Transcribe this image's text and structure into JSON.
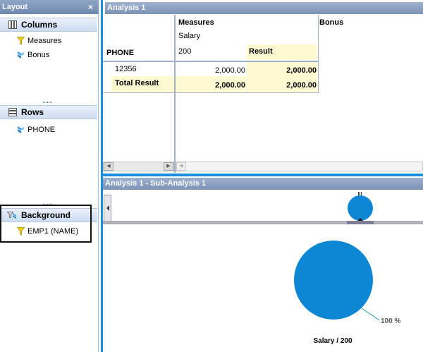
{
  "layout_panel": {
    "title": "Layout",
    "close_label": "×",
    "columns": {
      "label": "Columns",
      "items": [
        "Measures",
        "Bonus"
      ]
    },
    "rows": {
      "label": "Rows",
      "items": [
        "PHONE"
      ]
    },
    "background": {
      "label": "Background",
      "items": [
        "EMP1 (NAME)"
      ]
    }
  },
  "analysis": {
    "title": "Analysis 1",
    "crosstab": {
      "column_header_measures": "Measures",
      "column_header_bonus": "Bonus",
      "measure_name": "Salary",
      "measure_key": "200",
      "result_label": "Result",
      "row_header": "PHONE",
      "rows": [
        {
          "key": "12356",
          "value": "2,000.00",
          "result": "2,000.00"
        },
        {
          "key": "Total Result",
          "value": "2,000.00",
          "result": "2,000.00"
        }
      ]
    }
  },
  "sub_analysis": {
    "title": "Analysis 1 - Sub-Analysis 1",
    "nav_grip": "|||"
  },
  "chart_data": {
    "type": "pie",
    "categories": [
      "Salary / 200"
    ],
    "values": [
      100
    ],
    "slice_label": "100 %",
    "category_label": "Salary / 200",
    "color": "#0d86d4"
  }
}
